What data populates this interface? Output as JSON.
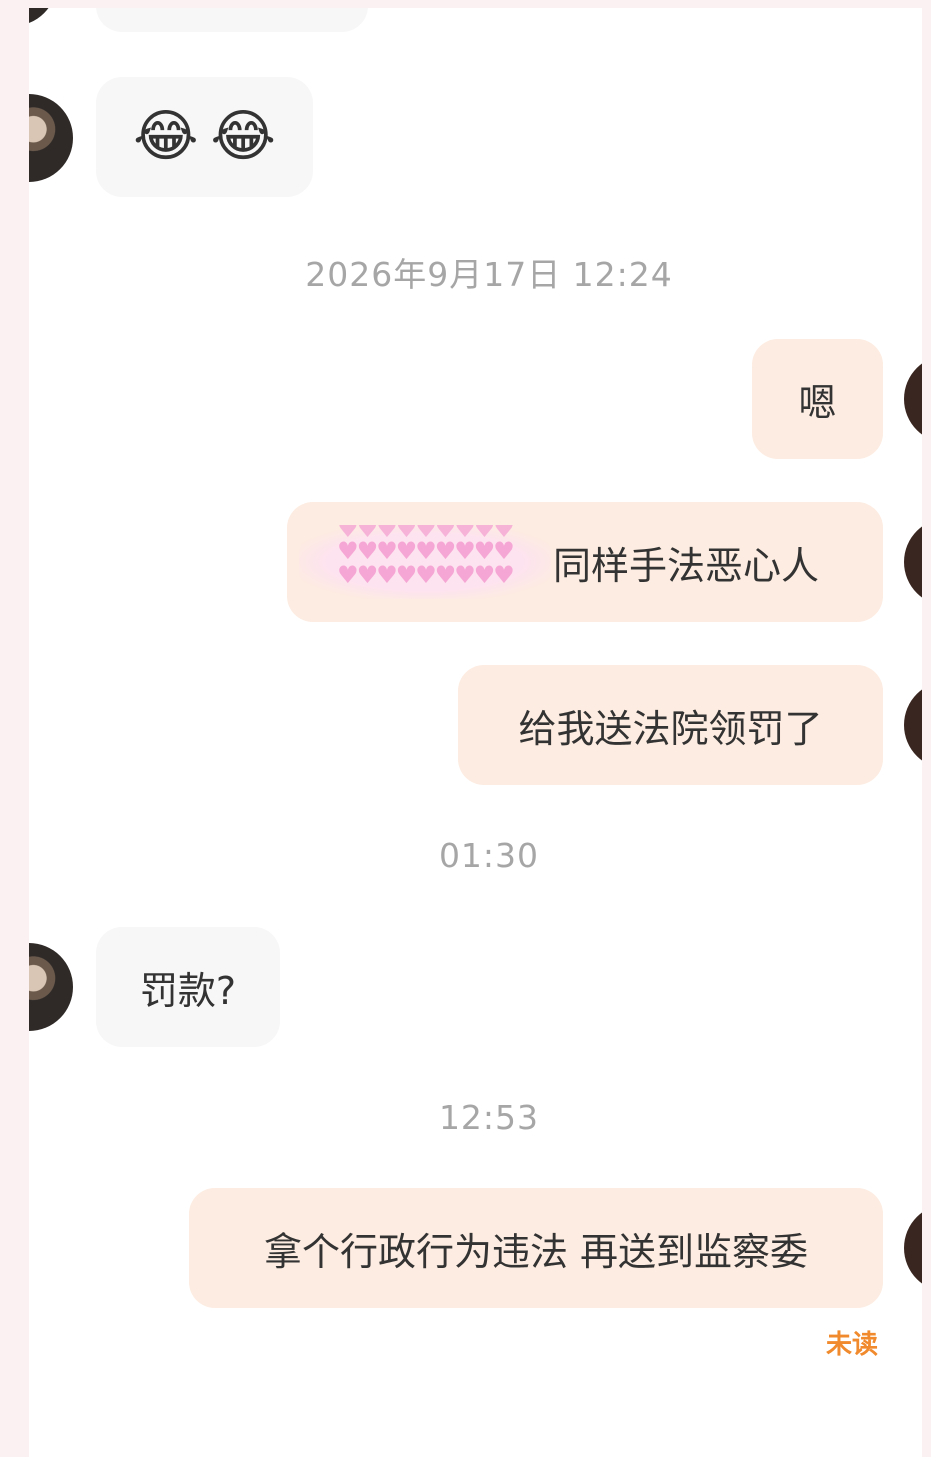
{
  "messages": [
    {
      "id": "m1",
      "direction": "in",
      "emojis": [
        "😂",
        "😂"
      ]
    },
    {
      "id": "t1",
      "type": "time",
      "text": "2026年9月17日 12:24"
    },
    {
      "id": "m2",
      "direction": "out",
      "text": "嗯"
    },
    {
      "id": "m3",
      "direction": "out",
      "censored_prefix": "♥♥♥♥♥♥♥♥♥",
      "text": "同样手法恶心人"
    },
    {
      "id": "m4",
      "direction": "out",
      "text": "给我送法院领罚了"
    },
    {
      "id": "t2",
      "type": "time",
      "text": "01:30"
    },
    {
      "id": "m5",
      "direction": "in",
      "text": "罚款?"
    },
    {
      "id": "t3",
      "type": "time",
      "text": "12:53"
    },
    {
      "id": "m6",
      "direction": "out",
      "text": "拿个行政行为违法 再送到监察委"
    }
  ],
  "status": {
    "unread_label": "未读"
  },
  "colors": {
    "incoming_bubble": "#f7f7f7",
    "outgoing_bubble": "#fdece1",
    "timestamp": "#a6a6a6",
    "unread": "#f08a2c",
    "censor_hearts": "#f6a6d4"
  }
}
